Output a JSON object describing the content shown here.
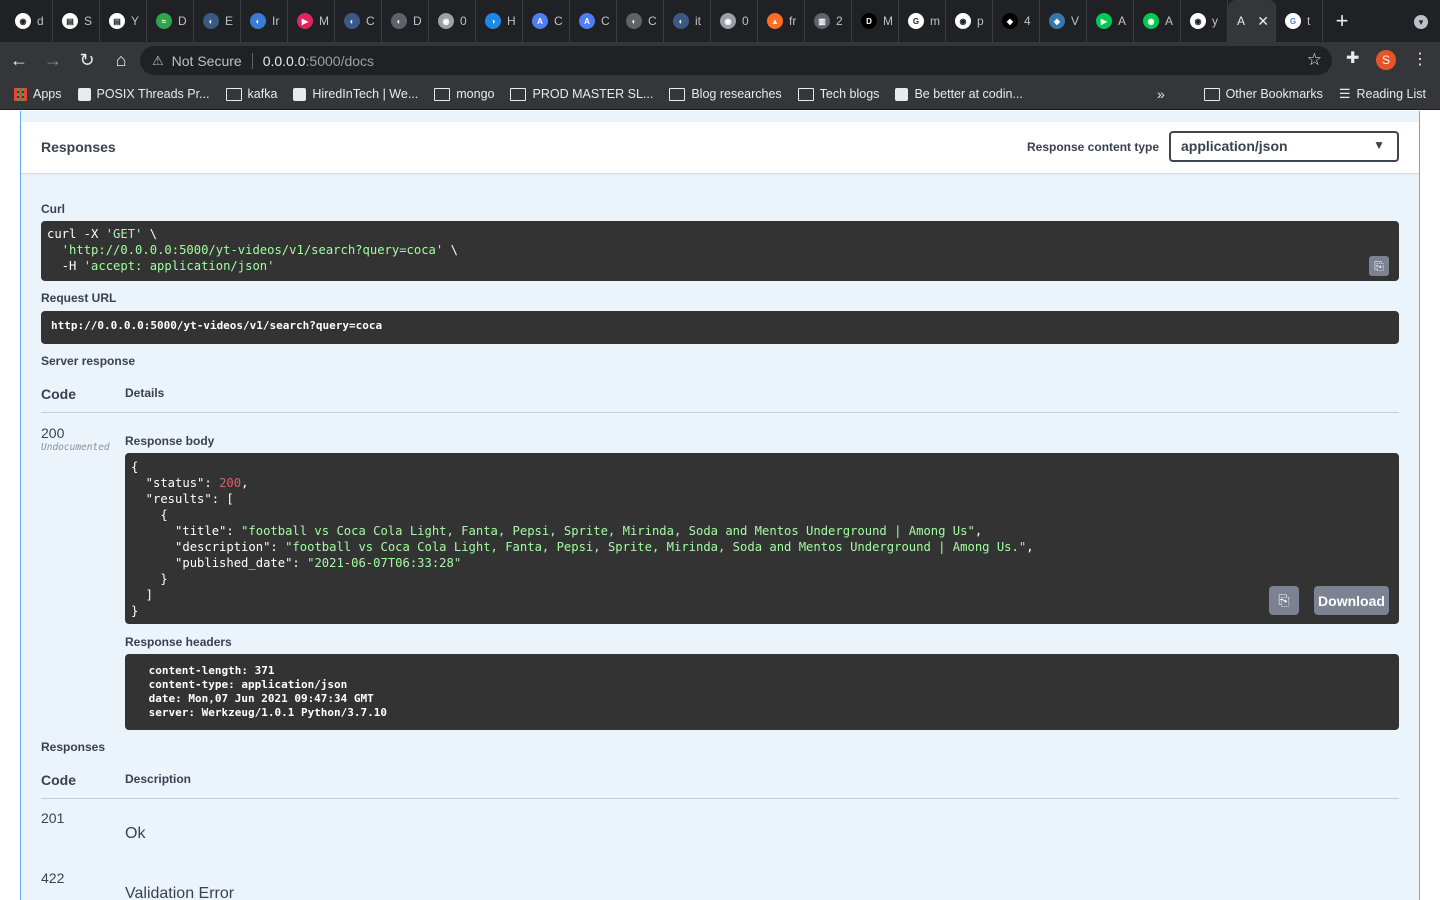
{
  "browser": {
    "tabs": [
      {
        "letter": "d",
        "color": "#ffffff",
        "glyph": "◉"
      },
      {
        "letter": "S",
        "color": "#ffffff",
        "glyph": "▤"
      },
      {
        "letter": "Y",
        "color": "#ffffff",
        "glyph": "▤"
      },
      {
        "letter": "D",
        "color": "#2da44e",
        "glyph": "≈"
      },
      {
        "letter": "E",
        "color": "#3a5a85",
        "glyph": "◐"
      },
      {
        "letter": "Ir",
        "color": "#3a7bd5",
        "glyph": "◐"
      },
      {
        "letter": "M",
        "color": "#e0245e",
        "glyph": "▶"
      },
      {
        "letter": "C",
        "color": "#3a5a85",
        "glyph": "◐"
      },
      {
        "letter": "D",
        "color": "#5f6368",
        "glyph": "◐"
      },
      {
        "letter": "0",
        "color": "#9aa0a6",
        "glyph": "◉"
      },
      {
        "letter": "H",
        "color": "#1e88e5",
        "glyph": "◑"
      },
      {
        "letter": "C",
        "color": "#4f7df3",
        "glyph": "A"
      },
      {
        "letter": "C",
        "color": "#4f7df3",
        "glyph": "A"
      },
      {
        "letter": "C",
        "color": "#5f6368",
        "glyph": "◐"
      },
      {
        "letter": "it",
        "color": "#3a5a85",
        "glyph": "◐"
      },
      {
        "letter": "0",
        "color": "#9aa0a6",
        "glyph": "◉"
      },
      {
        "letter": "fr",
        "color": "#fc6d26",
        "glyph": "▲"
      },
      {
        "letter": "2",
        "color": "#5f6368",
        "glyph": "▥"
      },
      {
        "letter": "M",
        "color": "#000000",
        "glyph": "D"
      },
      {
        "letter": "m",
        "color": "#ffffff",
        "glyph": "G"
      },
      {
        "letter": "p",
        "color": "#ffffff",
        "glyph": "◉"
      },
      {
        "letter": "4",
        "color": "#000000",
        "glyph": "◆"
      },
      {
        "letter": "V",
        "color": "#3776ab",
        "glyph": "◆"
      },
      {
        "letter": "A",
        "color": "#00c853",
        "glyph": "▶"
      },
      {
        "letter": "A",
        "color": "#00c853",
        "glyph": "◉"
      },
      {
        "letter": "y",
        "color": "#ffffff",
        "glyph": "◉"
      },
      {
        "letter": "A",
        "color": "#35363a",
        "glyph": "A"
      },
      {
        "letter": "t",
        "color": "#ffffff",
        "glyph": "G"
      }
    ],
    "active_tab_title": "A",
    "new_tab_label": "+",
    "nav": {
      "back": "←",
      "forward": "→",
      "reload": "↻",
      "home": "⌂"
    },
    "omnibox": {
      "warning_label": "Not Secure",
      "host": "0.0.0.0",
      "path": ":5000/docs"
    },
    "profile_initial": "S",
    "bookmarks": [
      {
        "label": "Apps",
        "icon": "apps-grid-icon"
      },
      {
        "label": "POSIX Threads Pr...",
        "icon": "site-icon"
      },
      {
        "label": "kafka",
        "icon": "folder-icon"
      },
      {
        "label": "HiredInTech | We...",
        "icon": "site-icon"
      },
      {
        "label": "mongo",
        "icon": "folder-icon"
      },
      {
        "label": "PROD MASTER SL...",
        "icon": "folder-icon"
      },
      {
        "label": "Blog researches",
        "icon": "folder-icon"
      },
      {
        "label": "Tech blogs",
        "icon": "folder-icon"
      },
      {
        "label": "Be better at codin...",
        "icon": "site-icon"
      }
    ],
    "other_bookmarks": "Other Bookmarks",
    "reading_list": "Reading List",
    "overflow": "»"
  },
  "responses_section": {
    "title": "Responses",
    "content_type_label": "Response content type",
    "content_type_value": "application/json"
  },
  "curl": {
    "label": "Curl",
    "line1_pre": "curl -X ",
    "line1_method": "'GET'",
    "line1_post": " \\",
    "line2_indent": "  ",
    "line2_url": "'http://0.0.0.0:5000/yt-videos/v1/search?query=coca'",
    "line2_post": " \\",
    "line3_pre": "  -H ",
    "line3_header": "'accept: application/json'"
  },
  "request_url": {
    "label": "Request URL",
    "value": "http://0.0.0.0:5000/yt-videos/v1/search?query=coca"
  },
  "server_response": {
    "label": "Server response",
    "code_header": "Code",
    "details_header": "Details",
    "code": "200",
    "undocumented": "Undocumented",
    "body_label": "Response body",
    "body": {
      "open": "{",
      "status_key": "  \"status\": ",
      "status_val": "200",
      "status_comma": ",",
      "results_key": "  \"results\": [",
      "obj_open": "    {",
      "title_key": "      \"title\": ",
      "title_val": "\"football vs Coca Cola Light, Fanta, Pepsi, Sprite, Mirinda, Soda and Mentos Underground | Among Us\"",
      "title_comma": ",",
      "desc_key": "      \"description\": ",
      "desc_val": "\"football vs Coca Cola Light, Fanta, Pepsi, Sprite, Mirinda, Soda and Mentos Underground | Among Us.\"",
      "desc_comma": ",",
      "date_key": "      \"published_date\": ",
      "date_val": "\"2021-06-07T06:33:28\"",
      "obj_close": "    }",
      "arr_close": "  ]",
      "close": "}"
    },
    "download_label": "Download",
    "headers_label": "Response headers",
    "headers": [
      " content-length: 371 ",
      " content-type: application/json ",
      " date: Mon,07 Jun 2021 09:47:34 GMT ",
      " server: Werkzeug/1.0.1 Python/3.7.10 "
    ]
  },
  "responses_table": {
    "title": "Responses",
    "code_header": "Code",
    "description_header": "Description",
    "rows": [
      {
        "code": "201",
        "description": "Ok"
      },
      {
        "code": "422",
        "description": "Validation Error"
      }
    ]
  },
  "colors": {
    "accent_get": "#61affe",
    "code_bg": "#333333",
    "string": "#a2fca2",
    "number": "#d36363"
  }
}
